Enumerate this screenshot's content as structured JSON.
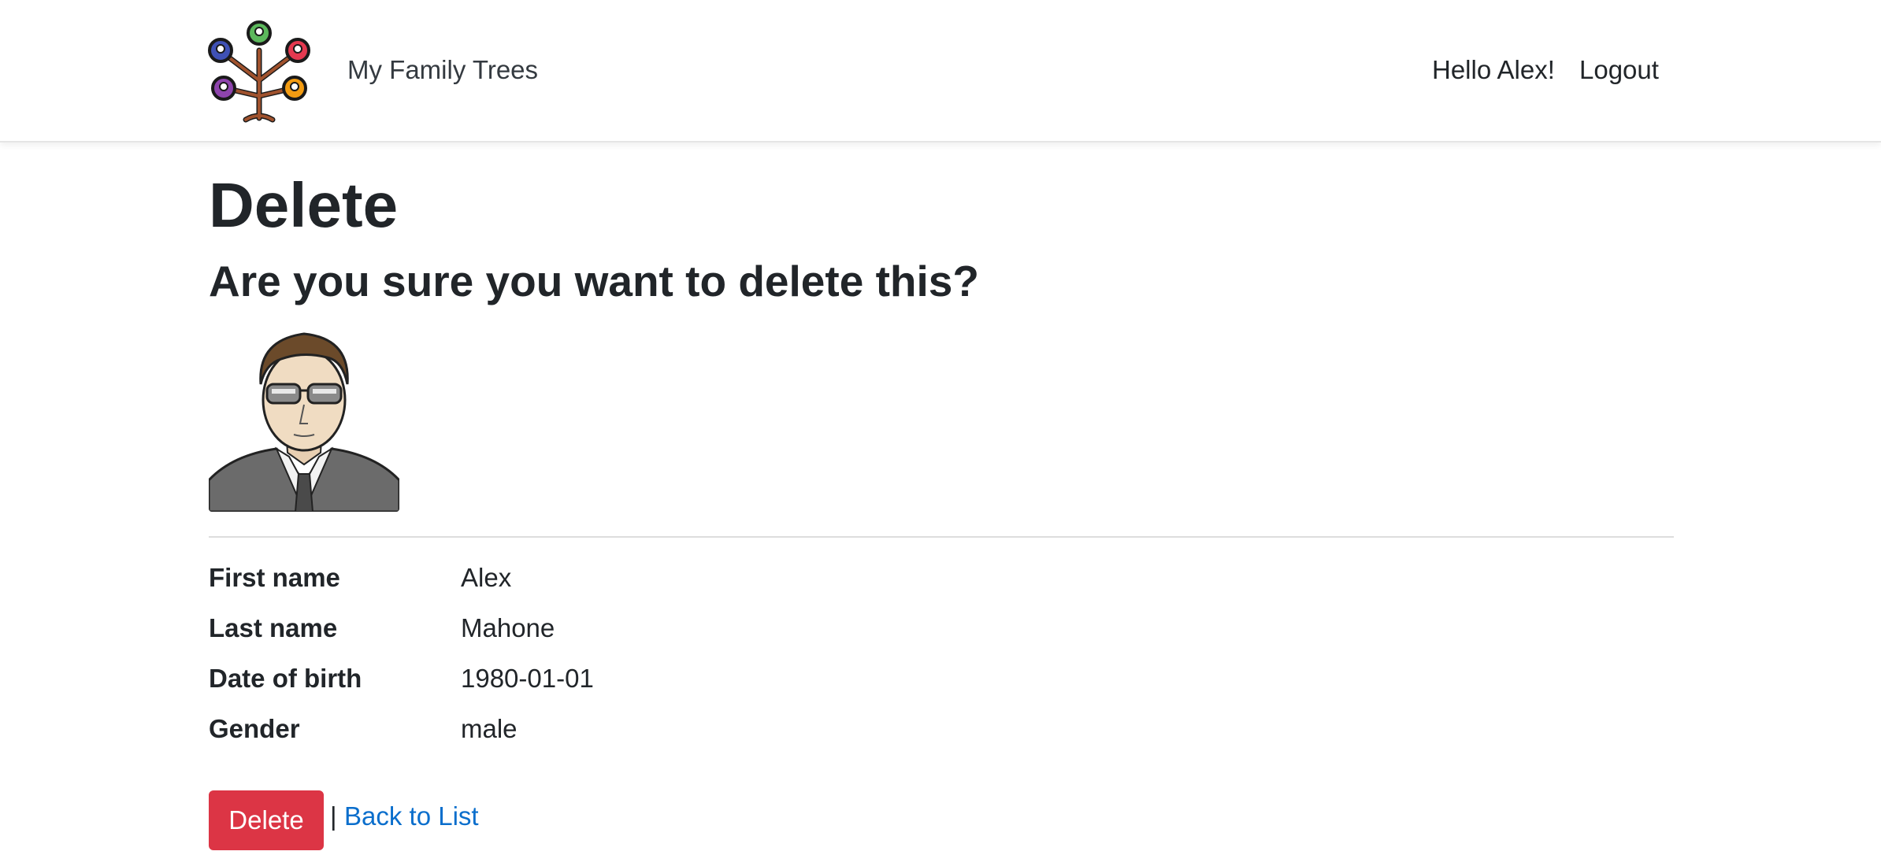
{
  "navbar": {
    "brand_text": "My Family Trees",
    "greeting": "Hello Alex!",
    "logout_label": "Logout"
  },
  "page": {
    "title": "Delete",
    "confirm_question": "Are you sure you want to delete this?"
  },
  "details": [
    {
      "label": "First name",
      "value": "Alex"
    },
    {
      "label": "Last name",
      "value": "Mahone"
    },
    {
      "label": "Date of birth",
      "value": "1980-01-01"
    },
    {
      "label": "Gender",
      "value": "male"
    }
  ],
  "actions": {
    "delete_label": "Delete",
    "separator": "|",
    "back_label": "Back to List"
  },
  "colors": {
    "danger": "#dc3545",
    "link": "#0a6ecc",
    "text": "#212529",
    "tree_trunk": "#a0522d"
  },
  "icons": {
    "brand": "family-tree-logo",
    "avatar": "person-avatar"
  }
}
